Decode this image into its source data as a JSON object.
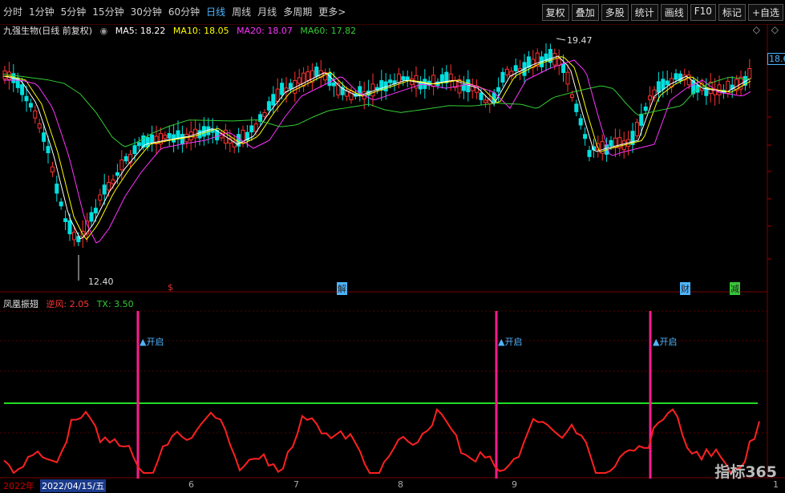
{
  "toolbar": {
    "periods": [
      "分时",
      "1分钟",
      "5分钟",
      "15分钟",
      "30分钟",
      "60分钟",
      "日线",
      "周线",
      "月线",
      "多周期",
      "更多>"
    ],
    "selected_index": 6,
    "buttons": [
      "复权",
      "叠加",
      "多股",
      "统计",
      "画线",
      "F10",
      "标记",
      "+自选"
    ]
  },
  "stock": {
    "title": "九强生物(日线 前复权)"
  },
  "ma": {
    "ma5": "MA5: 18.22",
    "ma10": "MA10: 18.05",
    "ma20": "MA20: 18.07",
    "ma60": "MA60: 17.82",
    "colors": {
      "ma5": "#ffffff",
      "ma10": "#ffff00",
      "ma20": "#ff33ff",
      "ma60": "#33cc33"
    }
  },
  "top_controls": [
    "◇",
    "◇",
    "◇"
  ],
  "price_labels": {
    "high": "19.47",
    "low": "12.40",
    "current_tag": "18.6"
  },
  "annotations": {
    "s": "$",
    "j": "解",
    "c": "财",
    "z": "减"
  },
  "indicator": {
    "name": "凤凰振翅",
    "nifeng": "逆风: 2.05",
    "tx": "TX: 3.50",
    "signal_label": "开启"
  },
  "date_axis": {
    "year": "2022年",
    "current": "2022/04/15/五",
    "months": [
      "6",
      "7",
      "8",
      "9",
      "1"
    ]
  },
  "watermark": "指标365"
}
